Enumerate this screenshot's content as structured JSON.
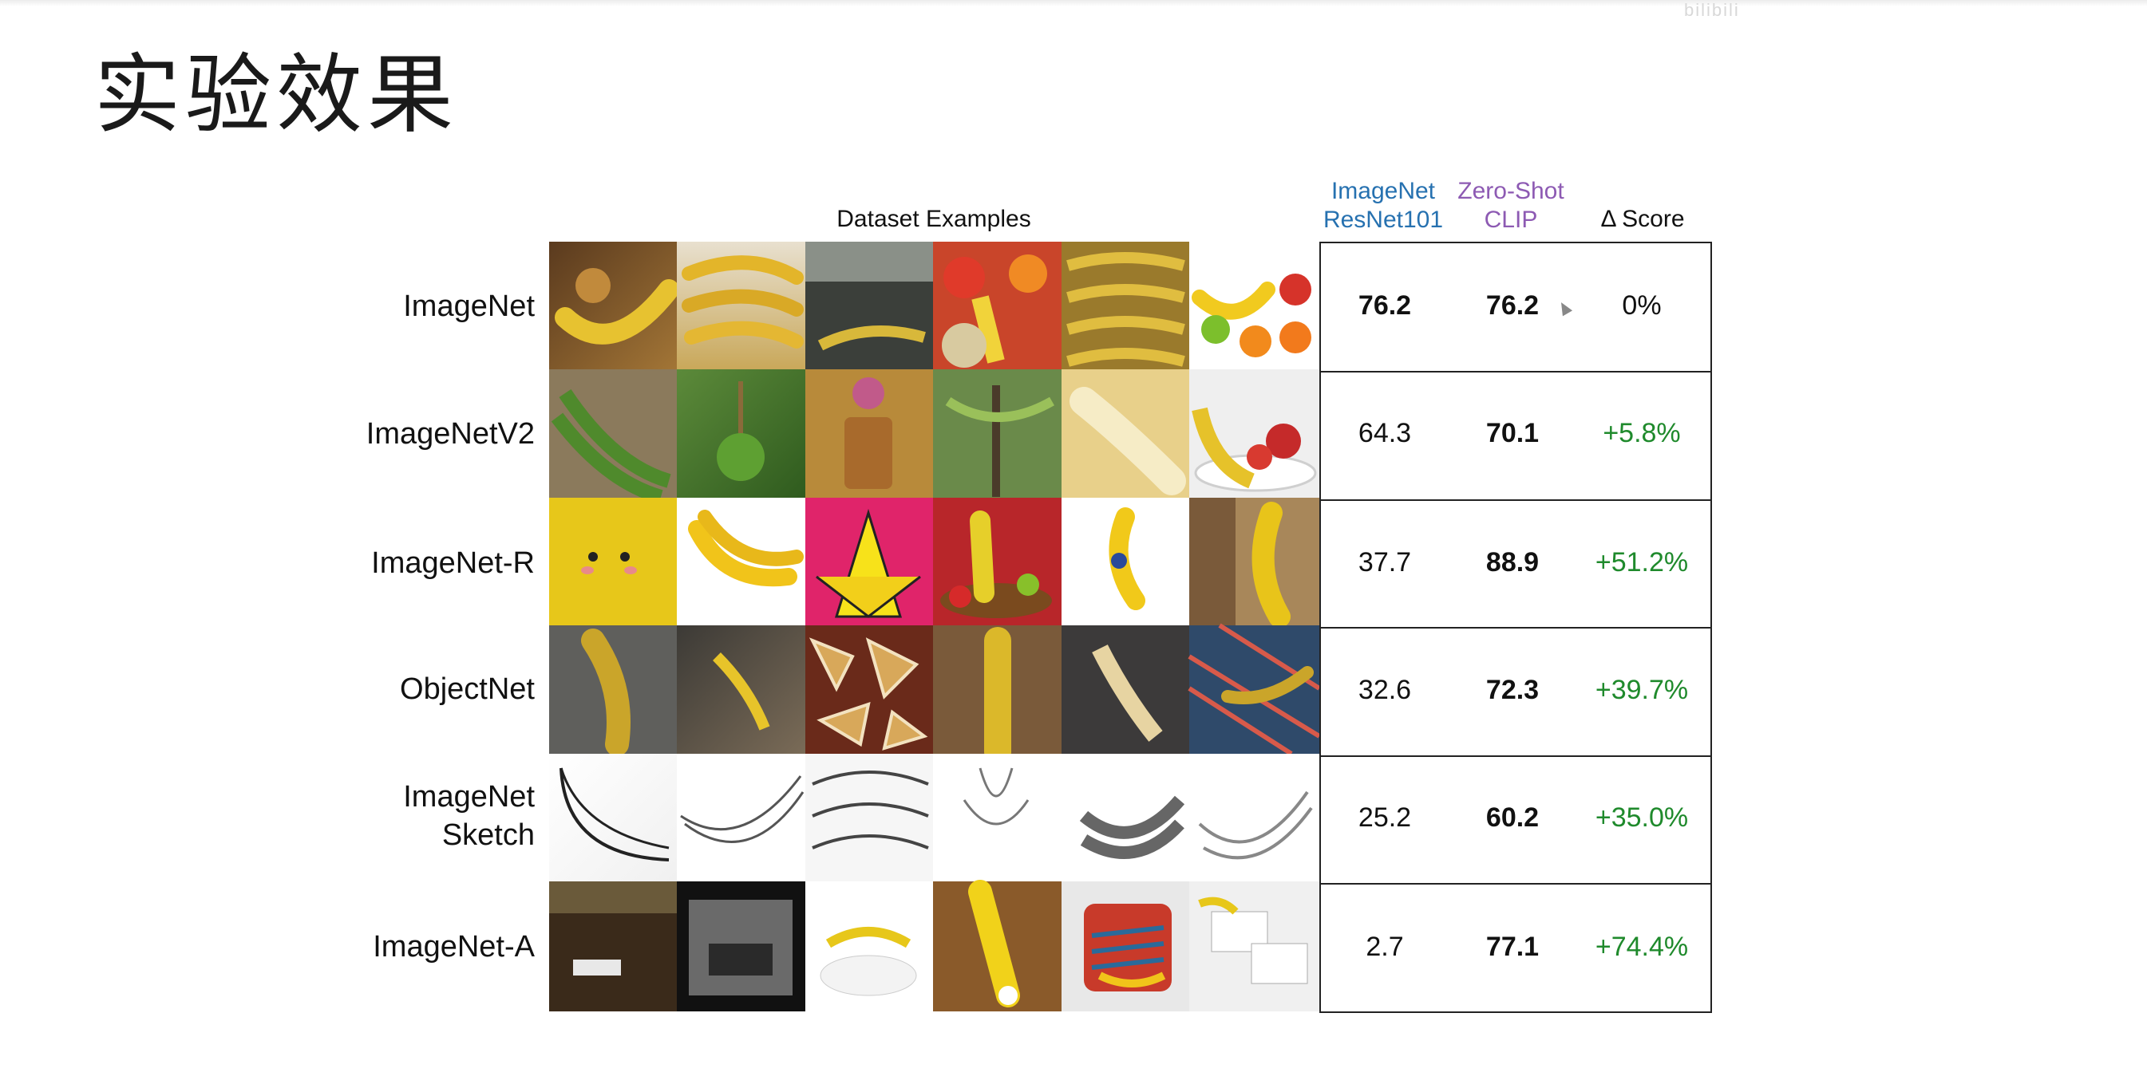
{
  "slide": {
    "title": "实验效果",
    "watermark": "bilibili"
  },
  "table": {
    "header_examples": "Dataset Examples",
    "header_resnet": "ImageNet\nResNet101",
    "header_clip": "Zero-Shot\nCLIP",
    "header_delta": "Δ Score",
    "rows": [
      {
        "label": "ImageNet",
        "resnet": "76.2",
        "clip": "76.2",
        "delta": "0%"
      },
      {
        "label": "ImageNetV2",
        "resnet": "64.3",
        "clip": "70.1",
        "delta": "+5.8%"
      },
      {
        "label": "ImageNet-R",
        "resnet": "37.7",
        "clip": "88.9",
        "delta": "+51.2%"
      },
      {
        "label": "ObjectNet",
        "resnet": "32.6",
        "clip": "72.3",
        "delta": "+39.7%"
      },
      {
        "label": "ImageNet\nSketch",
        "resnet": "25.2",
        "clip": "60.2",
        "delta": "+35.0%"
      },
      {
        "label": "ImageNet-A",
        "resnet": "2.7",
        "clip": "77.1",
        "delta": "+74.4%"
      }
    ]
  },
  "colors": {
    "resnet_header": "#2671b0",
    "clip_header": "#8d5ab3",
    "delta_positive": "#1f8a2c"
  }
}
